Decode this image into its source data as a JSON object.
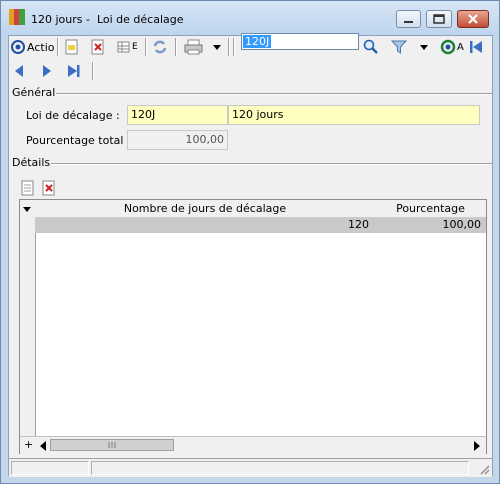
{
  "window": {
    "title": "120 jours -  Loi de décalage",
    "accent": "#bfd5ee"
  },
  "toolbar": {
    "action_label": "Actio",
    "e_label": "E",
    "search_value": "120J",
    "a_label": "A"
  },
  "general": {
    "section_label": "Général",
    "loi_label": "Loi de décalage :",
    "loi_code": "120J",
    "loi_name": "120 jours",
    "pourcentage_label": "Pourcentage total :",
    "pourcentage_value": "100,00"
  },
  "details": {
    "section_label": "Détails",
    "columns": [
      "Nombre de jours de décalage",
      "Pourcentage"
    ],
    "rows": [
      {
        "jours": "120",
        "pourcentage": "100,00"
      }
    ],
    "scroll_plus": "+"
  }
}
